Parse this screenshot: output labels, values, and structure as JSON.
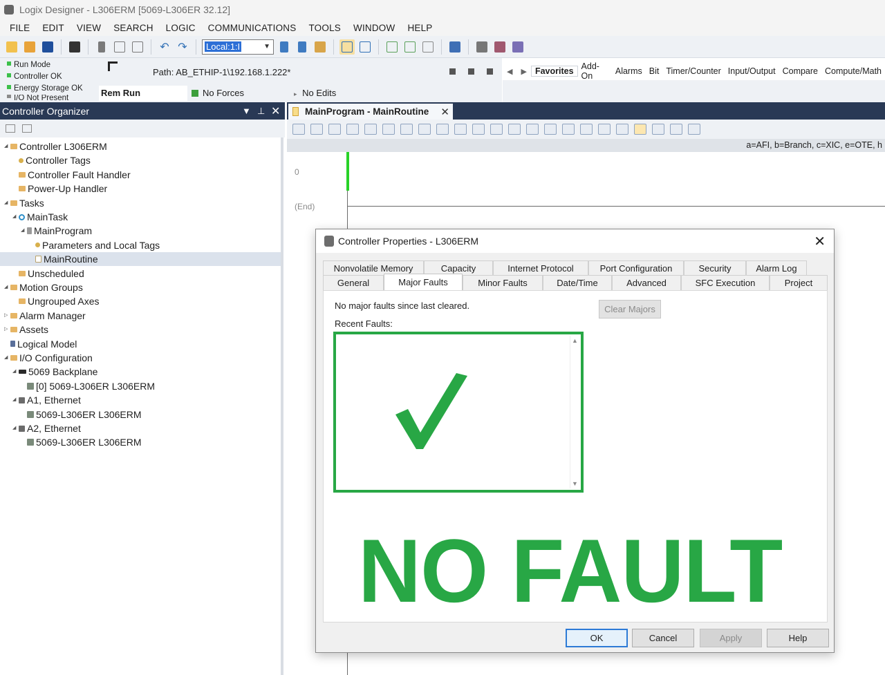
{
  "window": {
    "title": "Logix Designer - L306ERM [5069-L306ER 32.12]"
  },
  "menu": [
    "FILE",
    "EDIT",
    "VIEW",
    "SEARCH",
    "LOGIC",
    "COMMUNICATIONS",
    "TOOLS",
    "WINDOW",
    "HELP"
  ],
  "toolbar": {
    "path_combo_value": "Local:1:I",
    "icons": [
      "new-icon",
      "open-icon",
      "save-icon",
      "print-icon",
      "cut-icon",
      "copy-icon",
      "paste-icon",
      "undo-icon",
      "redo-icon"
    ]
  },
  "status": {
    "lines": [
      "Run Mode",
      "Controller OK",
      "Energy Storage OK",
      "I/O Not Present"
    ],
    "path": "Path: AB_ETHIP-1\\192.168.1.222*",
    "mode": "Rem Run",
    "forces": "No Forces",
    "edits": "No Edits"
  },
  "instruction_tabs": [
    "Favorites",
    "Add-On",
    "Alarms",
    "Bit",
    "Timer/Counter",
    "Input/Output",
    "Compare",
    "Compute/Math"
  ],
  "organizer": {
    "title": "Controller Organizer",
    "tree": [
      {
        "label": "Controller L306ERM",
        "indent": 0,
        "exp": "◢",
        "icon": "folder"
      },
      {
        "label": "Controller Tags",
        "indent": 1,
        "exp": "",
        "icon": "tag"
      },
      {
        "label": "Controller Fault Handler",
        "indent": 1,
        "exp": "",
        "icon": "folder"
      },
      {
        "label": "Power-Up Handler",
        "indent": 1,
        "exp": "",
        "icon": "folder"
      },
      {
        "label": "Tasks",
        "indent": 0,
        "exp": "◢",
        "icon": "folder"
      },
      {
        "label": "MainTask",
        "indent": 1,
        "exp": "◢",
        "icon": "task"
      },
      {
        "label": "MainProgram",
        "indent": 2,
        "exp": "◢",
        "icon": "prog"
      },
      {
        "label": "Parameters and Local Tags",
        "indent": 3,
        "exp": "",
        "icon": "tag"
      },
      {
        "label": "MainRoutine",
        "indent": 3,
        "exp": "",
        "icon": "routine",
        "selected": true
      },
      {
        "label": "Unscheduled",
        "indent": 1,
        "exp": "",
        "icon": "folder"
      },
      {
        "label": "Motion Groups",
        "indent": 0,
        "exp": "◢",
        "icon": "folder"
      },
      {
        "label": "Ungrouped Axes",
        "indent": 1,
        "exp": "",
        "icon": "folder"
      },
      {
        "label": "Alarm Manager",
        "indent": 0,
        "exp": "▷",
        "icon": "folder"
      },
      {
        "label": "Assets",
        "indent": 0,
        "exp": "▷",
        "icon": "folder"
      },
      {
        "label": "Logical Model",
        "indent": 0,
        "exp": "",
        "icon": "logic"
      },
      {
        "label": "I/O Configuration",
        "indent": 0,
        "exp": "◢",
        "icon": "folder"
      },
      {
        "label": "5069 Backplane",
        "indent": 1,
        "exp": "◢",
        "icon": "backplane"
      },
      {
        "label": "[0] 5069-L306ER L306ERM",
        "indent": 2,
        "exp": "",
        "icon": "module"
      },
      {
        "label": "A1, Ethernet",
        "indent": 1,
        "exp": "◢",
        "icon": "net"
      },
      {
        "label": "5069-L306ER L306ERM",
        "indent": 2,
        "exp": "",
        "icon": "module"
      },
      {
        "label": "A2, Ethernet",
        "indent": 1,
        "exp": "◢",
        "icon": "net"
      },
      {
        "label": "5069-L306ER L306ERM",
        "indent": 2,
        "exp": "",
        "icon": "module"
      }
    ]
  },
  "editor": {
    "tab_title": "MainProgram - MainRoutine",
    "mnemonic_hint": "a=AFI, b=Branch, c=XIC, e=OTE, h",
    "rung_number": "0",
    "end_label": "(End)"
  },
  "dialog": {
    "title": "Controller Properties - L306ERM",
    "tabs_row1": [
      "Nonvolatile Memory",
      "Capacity",
      "Internet Protocol",
      "Port Configuration",
      "Security",
      "Alarm Log"
    ],
    "tabs_row2": [
      "General",
      "Major Faults",
      "Minor Faults",
      "Date/Time",
      "Advanced",
      "SFC Execution",
      "Project"
    ],
    "active_tab": "Major Faults",
    "no_faults_message": "No major faults since last cleared.",
    "clear_button": "Clear Majors",
    "recent_faults_label": "Recent Faults:",
    "banner": "NO FAULT",
    "buttons": {
      "ok": "OK",
      "cancel": "Cancel",
      "apply": "Apply",
      "help": "Help"
    },
    "colors": {
      "ok_green": "#28a745"
    }
  }
}
